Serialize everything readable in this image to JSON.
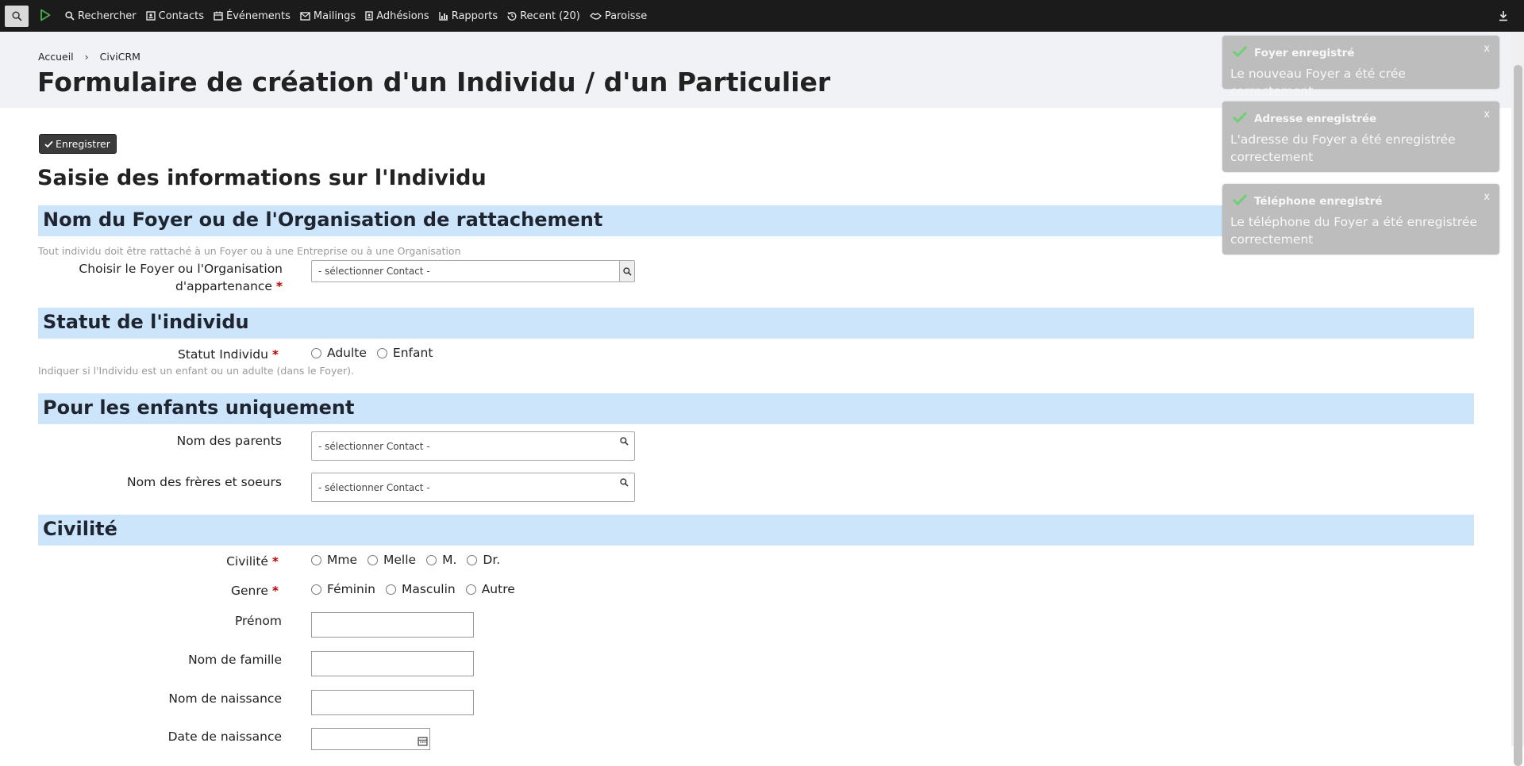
{
  "topbar": {
    "nav_items": [
      {
        "label": "Rechercher",
        "icon": "search-icon"
      },
      {
        "label": "Contacts",
        "icon": "contact-card-icon"
      },
      {
        "label": "Événements",
        "icon": "calendar-icon"
      },
      {
        "label": "Mailings",
        "icon": "envelope-icon"
      },
      {
        "label": "Adhésions",
        "icon": "id-badge-icon"
      },
      {
        "label": "Rapports",
        "icon": "bar-chart-icon"
      },
      {
        "label": "Recent (20)",
        "icon": "history-icon"
      },
      {
        "label": "Paroisse",
        "icon": "handshake-icon"
      }
    ]
  },
  "breadcrumb": {
    "home": "Accueil",
    "current": "CiviCRM"
  },
  "page_title": "Formulaire de création d'un Individu / d'un Particulier",
  "save_label": "Enregistrer",
  "form_title": "Saisie des informations sur l'Individu",
  "sections": {
    "foyer": {
      "title": "Nom du Foyer ou de l'Organisation de rattachement",
      "help": "Tout individu doit être rattaché à un Foyer ou à une Entreprise ou à une Organisation",
      "label_line1": "Choisir le Foyer ou l'Organisation",
      "label_line2": "d'appartenance",
      "placeholder": "- sélectionner Contact -"
    },
    "statut": {
      "title": "Statut de l'individu",
      "label": "Statut Individu",
      "options": [
        "Adulte",
        "Enfant"
      ],
      "help": "Indiquer si l'Individu est un enfant ou un adulte (dans le Foyer)."
    },
    "enfants": {
      "title": "Pour les enfants uniquement",
      "parents_label": "Nom des parents",
      "siblings_label": "Nom des frères et soeurs",
      "placeholder": "- sélectionner Contact -"
    },
    "civilite": {
      "title": "Civilité",
      "civilite_label": "Civilité",
      "civilite_options": [
        "Mme",
        "Melle",
        "M.",
        "Dr."
      ],
      "genre_label": "Genre",
      "genre_options": [
        "Féminin",
        "Masculin",
        "Autre"
      ],
      "prenom_label": "Prénom",
      "nom_label": "Nom de famille",
      "naissance_label": "Nom de naissance",
      "date_label": "Date de naissance"
    }
  },
  "required_marker": "*",
  "toasts": [
    {
      "title": "Foyer enregistré",
      "message": "Le nouveau Foyer a été crée correctement",
      "close": "x"
    },
    {
      "title": "Adresse enregistrée",
      "message": "L'adresse du Foyer a été enregistrée correctement",
      "close": "x"
    },
    {
      "title": "Téléphone enregistré",
      "message": "Le téléphone du Foyer a été enregistrée correctement",
      "close": "x"
    }
  ],
  "colors": {
    "topbar": "#1b1b1b",
    "section_bg": "#cce5fb",
    "header_bg": "#f1f2f6",
    "toast_bg": "#bdbdbd",
    "check": "#6fcf75"
  }
}
